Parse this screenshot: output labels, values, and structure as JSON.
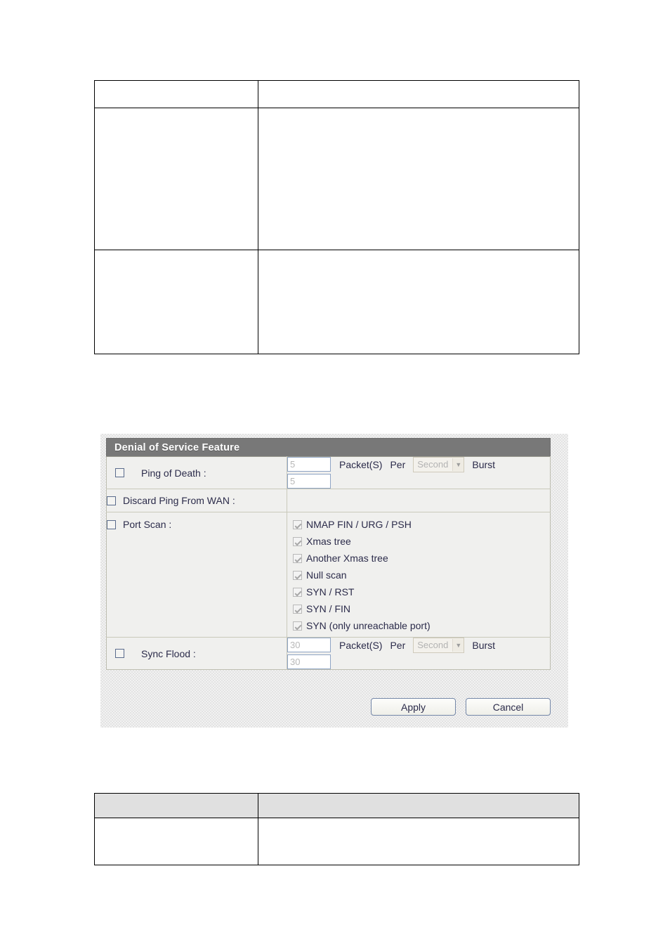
{
  "doc_tables": {
    "top": {
      "header": {
        "col_a": "",
        "col_b": ""
      },
      "rows": [
        {
          "col_a": "",
          "col_b": ""
        },
        {
          "col_a": "",
          "col_b": ""
        }
      ]
    },
    "bottom": {
      "header": {
        "col_a": "",
        "col_b": ""
      },
      "rows": [
        {
          "col_a": "",
          "col_b": ""
        }
      ]
    }
  },
  "dos_panel": {
    "title": "Denial of Service Feature",
    "rows": {
      "ping_of_death": {
        "label": "Ping of Death :",
        "checked": false,
        "packets_value": "5",
        "burst_value": "5",
        "packets_label": "Packet(S)",
        "per_label": "Per",
        "unit_value": "Second",
        "burst_label": "Burst"
      },
      "discard_ping": {
        "label": "Discard Ping From WAN :",
        "checked": false
      },
      "port_scan": {
        "label": "Port Scan :",
        "checked": false,
        "items": [
          {
            "label": "NMAP FIN / URG / PSH",
            "checked": true
          },
          {
            "label": "Xmas tree",
            "checked": true
          },
          {
            "label": "Another Xmas tree",
            "checked": true
          },
          {
            "label": "Null scan",
            "checked": true
          },
          {
            "label": "SYN / RST",
            "checked": true
          },
          {
            "label": "SYN / FIN",
            "checked": true
          },
          {
            "label": "SYN (only unreachable port)",
            "checked": true
          }
        ]
      },
      "sync_flood": {
        "label": "Sync Flood :",
        "checked": false,
        "packets_value": "30",
        "burst_value": "30",
        "packets_label": "Packet(S)",
        "per_label": "Per",
        "unit_value": "Second",
        "burst_label": "Burst"
      }
    },
    "buttons": {
      "apply": "Apply",
      "cancel": "Cancel"
    },
    "colors": {
      "title_bar": "#787878",
      "form_bg": "#f0f0ee",
      "text": "#2b2b4a",
      "button_border": "#7487a8"
    }
  }
}
